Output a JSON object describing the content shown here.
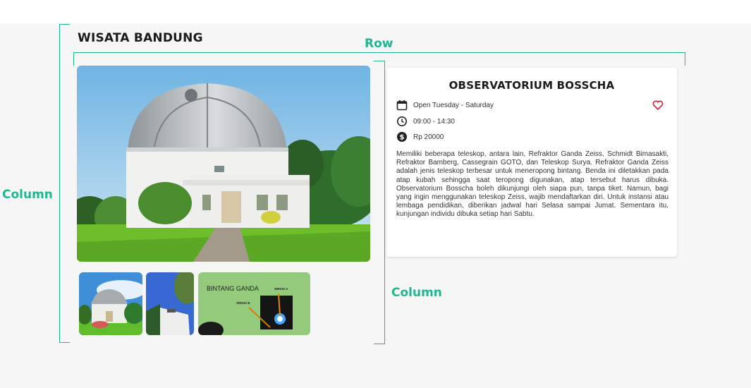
{
  "app": {
    "title": "WISATA BANDUNG"
  },
  "annotations": {
    "row": "Row",
    "column_left": "Column",
    "column_right": "Column"
  },
  "gallery": {
    "thumb_3_text": {
      "heading": "BINTANG GANDA",
      "label_a": "SIRIUS A",
      "label_b": "SIRIUS B"
    }
  },
  "detail": {
    "title": "OBSERVATORIUM BOSSCHA",
    "days": "Open Tuesday - Saturday",
    "hours": "09:00 - 14:30",
    "price": "Rp 20000",
    "description": "Memiliki beberapa teleskop, antara lain, Refraktor Ganda Zeiss, Schmidt Bimasakti, Refraktor Bamberg, Cassegrain GOTO, dan Teleskop Surya. Refraktor Ganda Zeiss adalah jenis teleskop terbesar untuk meneropong bintang. Benda ini diletakkan pada atap kubah sehingga saat teropong digunakan, atap tersebut harus dibuka. Observatorium Bosscha boleh dikunjungi oleh siapa pun, tanpa tiket. Namun, bagi yang ingin menggunakan teleskop Zeiss, wajib mendaftarkan diri. Untuk instansi atau lembaga pendidikan, diberikan jadwal hari Selasa sampai Jumat. Sementara itu, kunjungan individu dibuka setiap hari Sabtu."
  },
  "icons": {
    "days": "calendar-icon",
    "hours": "clock-icon",
    "price": "dollar-icon",
    "favorite": "heart-icon"
  },
  "colors": {
    "accent": "#1db88e",
    "favorite": "#d9263e",
    "text": "#1b1b1b"
  }
}
